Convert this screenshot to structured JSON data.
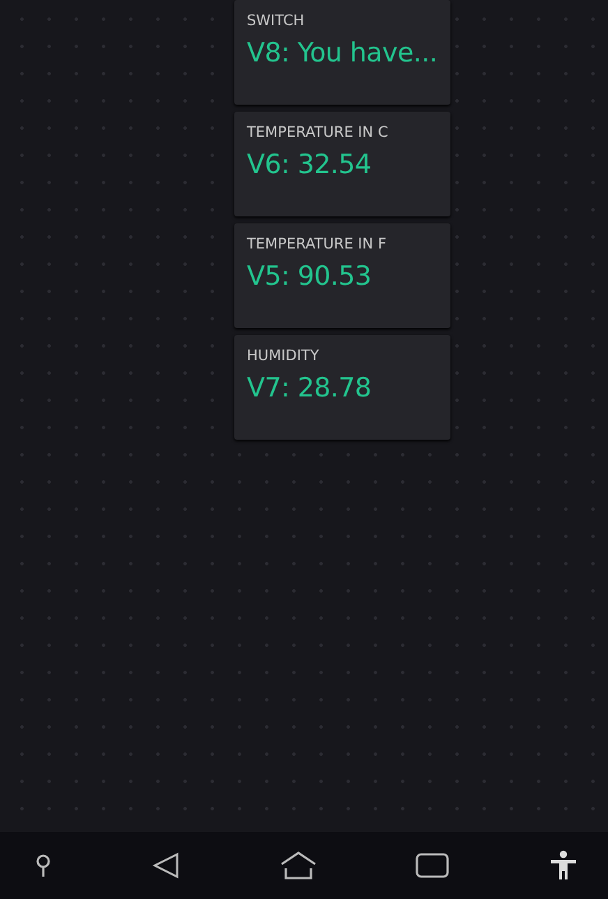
{
  "widgets": [
    {
      "label": "SWITCH",
      "value": "V8: You have..."
    },
    {
      "label": "TEMPERATURE IN C",
      "value": "V6: 32.54"
    },
    {
      "label": "TEMPERATURE IN F",
      "value": "V5: 90.53"
    },
    {
      "label": "HUMIDITY",
      "value": "V7: 28.78"
    }
  ]
}
